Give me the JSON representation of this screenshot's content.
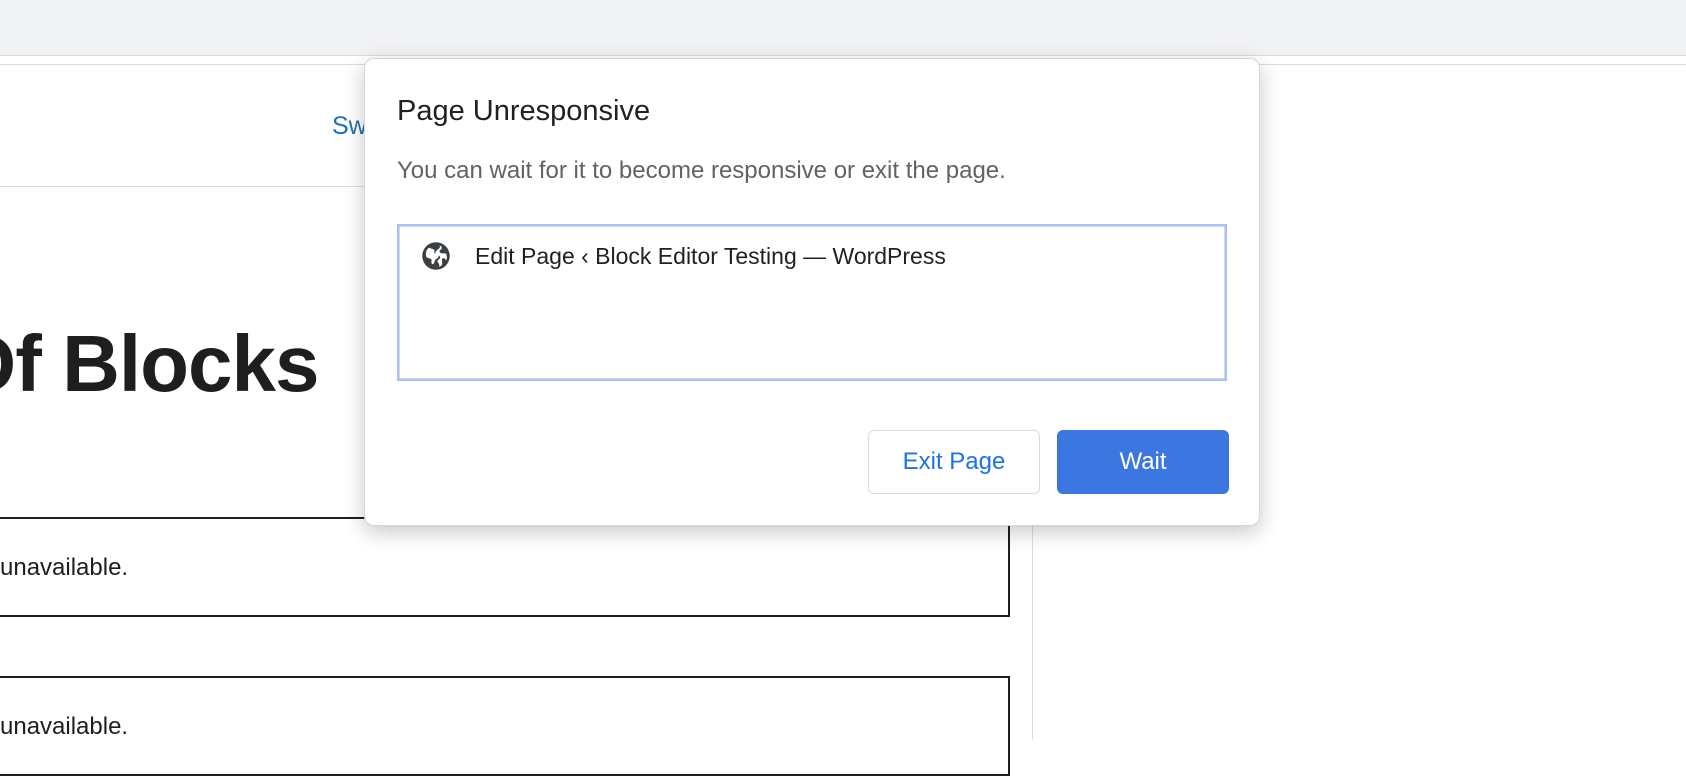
{
  "editor": {
    "header_link": "Sw",
    "heading": "Of Blocks",
    "blocks": [
      {
        "text": "unavailable."
      },
      {
        "text": "unavailable."
      }
    ]
  },
  "dialog": {
    "title": "Page Unresponsive",
    "description": "You can wait for it to become responsive or exit the page.",
    "pages": [
      {
        "icon": "globe-icon",
        "label": "Edit Page ‹ Block Editor Testing — WordPress"
      }
    ],
    "exit_label": "Exit Page",
    "wait_label": "Wait"
  },
  "colors": {
    "accent": "#3b76e1",
    "link": "#1a73e8"
  }
}
